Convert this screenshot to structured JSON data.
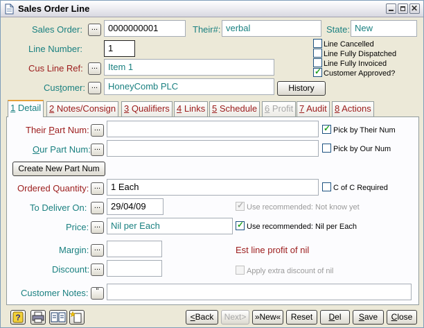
{
  "window": {
    "title": "Sales Order Line",
    "icons": [
      "document-icon",
      "minimize-icon",
      "maximize-icon",
      "close-icon"
    ]
  },
  "header": {
    "sales_order_label": "Sales Order:",
    "sales_order_value": "0000000001",
    "their_label": "Their#:",
    "their_value": "verbal",
    "state_label": "State:",
    "state_value": "New",
    "line_number_label": "Line Number:",
    "line_number_value": "1",
    "cus_line_ref_label": "Cus Line Ref:",
    "cus_line_ref_value": "Item 1",
    "customer_label": "Customer:",
    "customer_value": "HoneyComb PLC",
    "history_button": "History",
    "checks": [
      {
        "label": "Line Cancelled",
        "checked": false
      },
      {
        "label": "Line Fully Dispatched",
        "checked": false
      },
      {
        "label": "Line Fully Invoiced",
        "checked": false
      },
      {
        "label": "Customer Approved?",
        "checked": true
      }
    ]
  },
  "tabs": [
    {
      "num": "1",
      "label": "Detail",
      "active": true
    },
    {
      "num": "2",
      "label": "Notes/Consign"
    },
    {
      "num": "3",
      "label": "Qualifiers"
    },
    {
      "num": "4",
      "label": "Links"
    },
    {
      "num": "5",
      "label": "Schedule"
    },
    {
      "num": "6",
      "label": "Profit",
      "disabled": true
    },
    {
      "num": "7",
      "label": "Audit"
    },
    {
      "num": "8",
      "label": "Actions"
    }
  ],
  "detail": {
    "their_part_label": "Their Part Num:",
    "their_part_value": "",
    "pick_by_their": {
      "label": "Pick by Their Num",
      "checked": true
    },
    "our_part_label": "Our Part Num:",
    "our_part_value": "",
    "pick_by_our": {
      "label": "Pick by Our Num",
      "checked": false
    },
    "create_part_button": "Create New Part Num",
    "ordered_qty_label": "Ordered Quantity:",
    "ordered_qty_value": "1 Each",
    "c_of_c": {
      "label": "C of C Required",
      "checked": false
    },
    "deliver_label": "To Deliver On:",
    "deliver_value": "29/04/09",
    "use_recommended_deliver": {
      "label": "Use recommended: Not know yet",
      "checked": true,
      "disabled": true
    },
    "price_label": "Price:",
    "price_value": "Nil per Each",
    "use_recommended_price": {
      "label": "Use recommended: Nil per Each",
      "checked": true
    },
    "margin_label": "Margin:",
    "margin_value": "",
    "est_profit": "Est line profit of nil",
    "discount_label": "Discount:",
    "discount_value": "",
    "apply_discount": {
      "label": "Apply extra discount of nil",
      "checked": false,
      "disabled": true
    },
    "customer_notes_label": "Customer Notes:",
    "customer_notes_value": ""
  },
  "footer": {
    "back": "<Back",
    "next": "Next>",
    "new": "»New«",
    "reset": "Reset",
    "del": "Del",
    "save": "Save",
    "close": "Close",
    "toolbar_icons": [
      "help-icon",
      "print-icon",
      "compare-icon",
      "new-document-icon"
    ]
  },
  "colors": {
    "teal_label": "#1a8080",
    "red_label": "#9b1b1b",
    "window_bg": "#ece9d8",
    "tab_highlight": "#e6a23c"
  }
}
